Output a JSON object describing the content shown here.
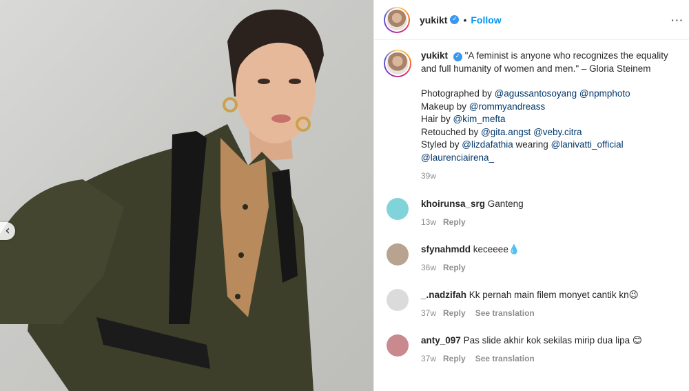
{
  "post": {
    "username": "yukikt",
    "follow_label": "Follow",
    "dot": "•",
    "verified_glyph": "✓",
    "more_glyph": "···",
    "prev_glyph": "‹"
  },
  "caption": {
    "username": "yukikt",
    "quote": " \"A feminist is anyone who recognizes the equality and full humanity of women and men.\" – Gloria Steinem",
    "lines": [
      {
        "prefix": "Photographed by ",
        "links": [
          "@agussantosoyang",
          "@npmphoto"
        ]
      },
      {
        "prefix": "Makeup by ",
        "links": [
          "@rommyandreass"
        ]
      },
      {
        "prefix": "Hair by ",
        "links": [
          "@kim_mefta"
        ]
      },
      {
        "prefix": "Retouched by ",
        "links": [
          "@gita.angst",
          "@veby.citra"
        ]
      },
      {
        "prefix": "Styled by ",
        "links": [
          "@lizdafathia"
        ],
        "middle": " wearing ",
        "links2": [
          "@lanivatti_official",
          "@laurenciairena_"
        ]
      }
    ],
    "time": "39w"
  },
  "comments": [
    {
      "username": "khoirunsa_srg",
      "text": "Ganteng",
      "time": "13w",
      "reply": "Reply",
      "translate": "",
      "avatar_color": "#7fd3d9"
    },
    {
      "username": "sfynahmdd",
      "text": "keceeee💧",
      "time": "36w",
      "reply": "Reply",
      "translate": "",
      "avatar_color": "#b7a38f"
    },
    {
      "username": "_.nadzifah",
      "text": "Kk pernah main filem monyet cantik kn😉",
      "time": "37w",
      "reply": "Reply",
      "translate": "See translation",
      "avatar_color": "#dbdbdb"
    },
    {
      "username": "anty_097",
      "text": "Pas slide akhir kok sekilas mirip dua lipa 😊",
      "time": "37w",
      "reply": "Reply",
      "translate": "See translation",
      "avatar_color": "#c98a8f"
    }
  ],
  "colors": {
    "accent": "#0095f6",
    "verified": "#3897f0",
    "muted": "#8e8e8e",
    "link": "#00376b"
  }
}
